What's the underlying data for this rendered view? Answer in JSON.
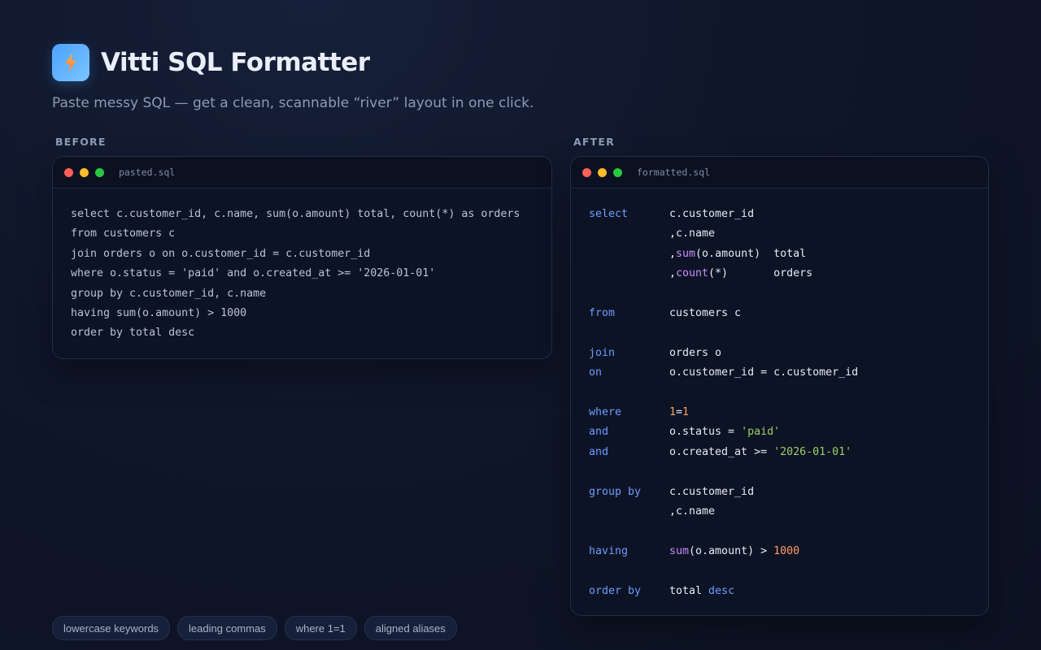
{
  "app": {
    "title": "Vitti SQL Formatter",
    "subtitle": "Paste messy SQL — get a clean, scannable “river” layout in one click.",
    "logo_icon": "lightning-bolt-icon"
  },
  "before": {
    "label": "BEFORE",
    "filename": "pasted.sql",
    "lines": [
      "select c.customer_id, c.name, sum(o.amount) total, count(*) as orders",
      "from customers c",
      "join orders o on o.customer_id = c.customer_id",
      "where o.status = 'paid' and o.created_at >= '2026-01-01'",
      "group by c.customer_id, c.name",
      "having sum(o.amount) > 1000",
      "order by total desc"
    ]
  },
  "after": {
    "label": "AFTER",
    "filename": "formatted.sql",
    "lines": [
      {
        "kw": "select",
        "tokens": [
          {
            "t": "c.customer_id"
          }
        ]
      },
      {
        "kw": "",
        "tokens": [
          {
            "t": ",c.name"
          }
        ]
      },
      {
        "kw": "",
        "tokens": [
          {
            "t": ","
          },
          {
            "t": "sum",
            "c": "fn"
          },
          {
            "t": "(o.amount)  total"
          }
        ]
      },
      {
        "kw": "",
        "tokens": [
          {
            "t": ","
          },
          {
            "t": "count",
            "c": "fn"
          },
          {
            "t": "(*)       orders"
          }
        ]
      },
      {
        "kw": "",
        "tokens": []
      },
      {
        "kw": "from",
        "tokens": [
          {
            "t": "customers c"
          }
        ]
      },
      {
        "kw": "",
        "tokens": []
      },
      {
        "kw": "join",
        "tokens": [
          {
            "t": "orders o"
          }
        ]
      },
      {
        "kw": "on",
        "tokens": [
          {
            "t": "o.customer_id = c.customer_id"
          }
        ]
      },
      {
        "kw": "",
        "tokens": []
      },
      {
        "kw": "where",
        "tokens": [
          {
            "t": "1",
            "c": "num"
          },
          {
            "t": "="
          },
          {
            "t": "1",
            "c": "num"
          }
        ]
      },
      {
        "kw": "and",
        "tokens": [
          {
            "t": "o.status = "
          },
          {
            "t": "'paid'",
            "c": "str"
          }
        ]
      },
      {
        "kw": "and",
        "tokens": [
          {
            "t": "o.created_at >= "
          },
          {
            "t": "'2026-01-01'",
            "c": "str"
          }
        ]
      },
      {
        "kw": "",
        "tokens": []
      },
      {
        "kw": "group by",
        "tokens": [
          {
            "t": "c.customer_id"
          }
        ]
      },
      {
        "kw": "",
        "tokens": [
          {
            "t": ",c.name"
          }
        ]
      },
      {
        "kw": "",
        "tokens": []
      },
      {
        "kw": "having",
        "tokens": [
          {
            "t": "sum",
            "c": "fn"
          },
          {
            "t": "(o.amount) > "
          },
          {
            "t": "1000",
            "c": "num"
          }
        ]
      },
      {
        "kw": "",
        "tokens": []
      },
      {
        "kw": "order by",
        "tokens": [
          {
            "t": "total "
          },
          {
            "t": "desc",
            "c": "kw"
          }
        ]
      }
    ]
  },
  "tags": [
    "lowercase keywords",
    "leading commas",
    "where 1=1",
    "aligned aliases"
  ],
  "colors": {
    "keyword": "#6f9cff",
    "function": "#c98cff",
    "number": "#ff9e64",
    "string": "#9ece6a"
  }
}
